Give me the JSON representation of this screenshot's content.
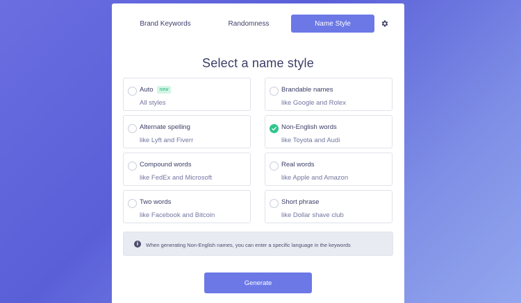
{
  "tabs": {
    "brand_keywords": "Brand Keywords",
    "randomness": "Randomness",
    "name_style": "Name Style"
  },
  "heading": "Select a name style",
  "options": [
    {
      "title": "Auto",
      "badge": "new",
      "subtitle": "All styles",
      "checked": false
    },
    {
      "title": "Brandable names",
      "subtitle": "like Google and Rolex",
      "checked": false
    },
    {
      "title": "Alternate spelling",
      "subtitle": "like Lyft and Fiverr",
      "checked": false
    },
    {
      "title": "Non-English words",
      "subtitle": "like Toyota and Audi",
      "checked": true
    },
    {
      "title": "Compound words",
      "subtitle": "like FedEx and Microsoft",
      "checked": false
    },
    {
      "title": "Real words",
      "subtitle": "like Apple and Amazon",
      "checked": false
    },
    {
      "title": "Two words",
      "subtitle": "like Facebook and Bitcoin",
      "checked": false
    },
    {
      "title": "Short phrase",
      "subtitle": "like Dollar shave club",
      "checked": false
    }
  ],
  "info": {
    "icon": "info-icon",
    "text": "When generating Non-English names, you can enter a specific language in the keywords"
  },
  "generate_label": "Generate",
  "colors": {
    "accent": "#6b78e6",
    "check": "#2fc58d",
    "badge_bg": "#d3f5e6",
    "badge_text": "#23b77c"
  }
}
